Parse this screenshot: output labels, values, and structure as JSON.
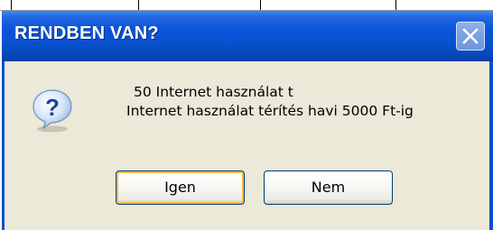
{
  "dialog": {
    "title": "RENDBEN VAN?",
    "message_line1": "50 Internet használat t",
    "message_line2": "Internet használat térítés havi 5000 Ft-ig",
    "icon": "question-icon",
    "buttons": {
      "yes": "Igen",
      "no": "Nem"
    },
    "close_icon": "close-icon"
  },
  "colors": {
    "titlebar": "#0752d2",
    "dialog_background": "#ece9d8",
    "button_border": "#003c74",
    "focus_highlight": "#f8b334"
  }
}
